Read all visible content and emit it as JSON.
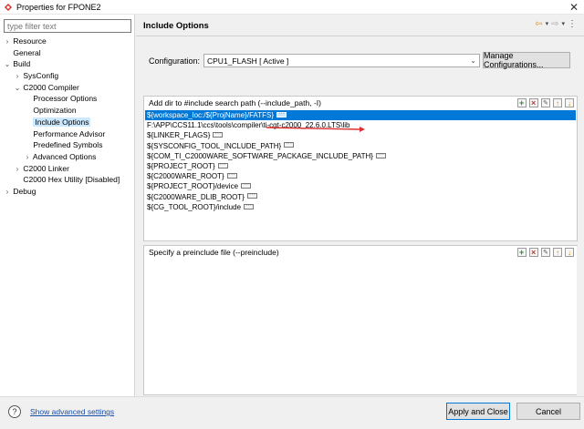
{
  "window": {
    "title": "Properties for FPONE2",
    "close_glyph": "✕",
    "icon": "app-logo-icon"
  },
  "sidebar": {
    "filter_placeholder": "type filter text",
    "items": [
      {
        "label": "Resource",
        "twisty": "›",
        "depth": 0
      },
      {
        "label": "General",
        "twisty": "",
        "depth": 0
      },
      {
        "label": "Build",
        "twisty": "⌄",
        "depth": 0
      },
      {
        "label": "SysConfig",
        "twisty": "›",
        "depth": 1
      },
      {
        "label": "C2000 Compiler",
        "twisty": "⌄",
        "depth": 1
      },
      {
        "label": "Processor Options",
        "twisty": "",
        "depth": 2
      },
      {
        "label": "Optimization",
        "twisty": "",
        "depth": 2
      },
      {
        "label": "Include Options",
        "twisty": "",
        "depth": 2,
        "selected": true
      },
      {
        "label": "Performance Advisor",
        "twisty": "",
        "depth": 2
      },
      {
        "label": "Predefined Symbols",
        "twisty": "",
        "depth": 2
      },
      {
        "label": "Advanced Options",
        "twisty": "›",
        "depth": 2
      },
      {
        "label": "C2000 Linker",
        "twisty": "›",
        "depth": 1
      },
      {
        "label": "C2000 Hex Utility  [Disabled]",
        "twisty": "",
        "depth": 1
      },
      {
        "label": "Debug",
        "twisty": "›",
        "depth": 0
      }
    ]
  },
  "header": {
    "title": "Include Options",
    "nav_icons": [
      "back-arrow-icon",
      "dropdown-icon",
      "forward-arrow-icon",
      "dropdown-icon",
      "menu-icon"
    ]
  },
  "configuration": {
    "label": "Configuration:",
    "value": "CPU1_FLASH  [ Active ]",
    "manage_button": "Manage Configurations..."
  },
  "include_paths": {
    "header": "Add dir to #include search path (--include_path, -I)",
    "rows": [
      {
        "text": "${workspace_loc:/${ProjName}/FATFS}",
        "badge": true,
        "selected": true
      },
      {
        "text": "F:\\APP\\CCS11.1\\ccs\\tools\\compiler\\ti-cgt-c2000_22.6.0.LTS\\lib",
        "badge": false
      },
      {
        "text": "${LINKER_FLAGS}",
        "badge": true
      },
      {
        "text": "${SYSCONFIG_TOOL_INCLUDE_PATH}",
        "badge": true
      },
      {
        "text": "${COM_TI_C2000WARE_SOFTWARE_PACKAGE_INCLUDE_PATH}",
        "badge": true
      },
      {
        "text": "${PROJECT_ROOT}",
        "badge": true
      },
      {
        "text": "${C2000WARE_ROOT}",
        "badge": true
      },
      {
        "text": "${PROJECT_ROOT}/device",
        "badge": true
      },
      {
        "text": "${C2000WARE_DLIB_ROOT}",
        "badge": true
      },
      {
        "text": "${CG_TOOL_ROOT}/include",
        "badge": true
      }
    ]
  },
  "preinclude": {
    "header": "Specify a preinclude file (--preinclude)",
    "rows": []
  },
  "annotation": {
    "arrow_color": "#e03030"
  },
  "footer": {
    "help_glyph": "?",
    "advanced_link": "Show advanced settings",
    "apply_button": "Apply and Close",
    "cancel_button": "Cancel"
  }
}
